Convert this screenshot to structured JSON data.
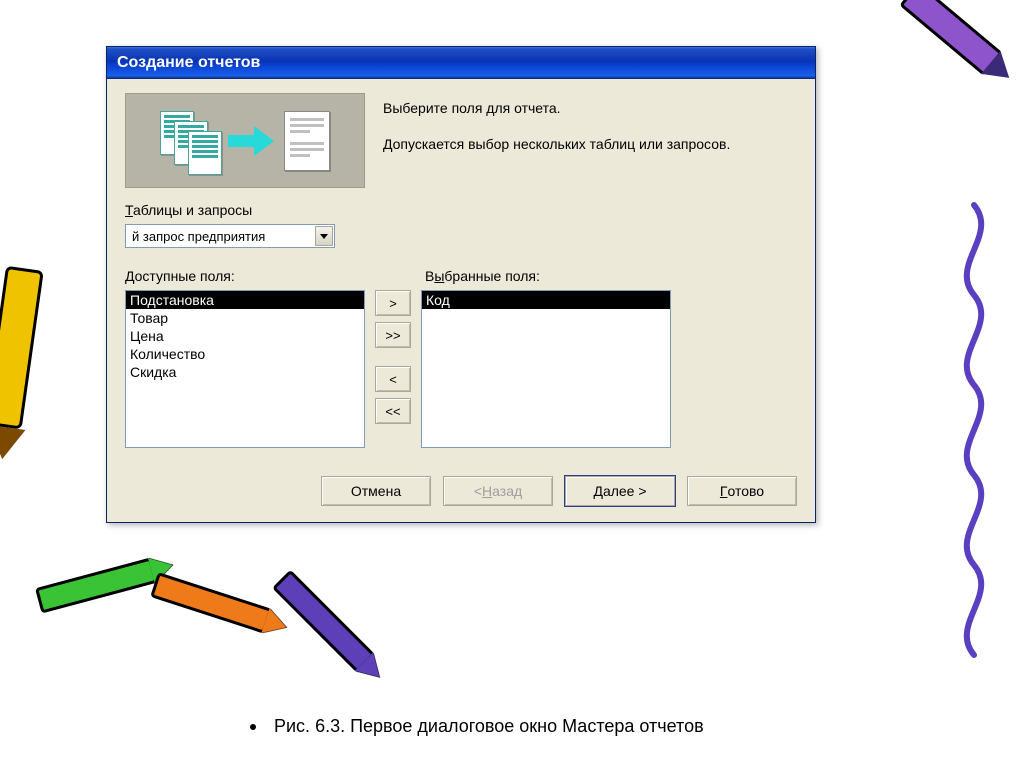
{
  "dialog": {
    "title": "Создание отчетов",
    "intro_line1": "Выберите поля для отчета.",
    "intro_line2": "Допускается выбор нескольких таблиц или запросов.",
    "tables_label_pre": "Т",
    "tables_label_rest": "аблицы и запросы",
    "combo_value": "й запрос предприятия",
    "available_label_pre": "Д",
    "available_label_rest": "оступные поля:",
    "selected_label": "Выбранные поля:",
    "available_fields": [
      "Подстановка",
      "Товар",
      "Цена",
      "Количество",
      "Скидка"
    ],
    "available_selected_index": 0,
    "selected_fields": [
      "Код"
    ],
    "selected_selected_index": 0,
    "move": {
      "add": ">",
      "add_all": ">>",
      "remove": "<",
      "remove_all": "<<"
    },
    "buttons": {
      "cancel": "Отмена",
      "back": "< Назад",
      "next": "Далее >",
      "finish": "Готово"
    }
  },
  "caption": "Рис. 6.3. Первое диалоговое окно Мастера отчетов"
}
